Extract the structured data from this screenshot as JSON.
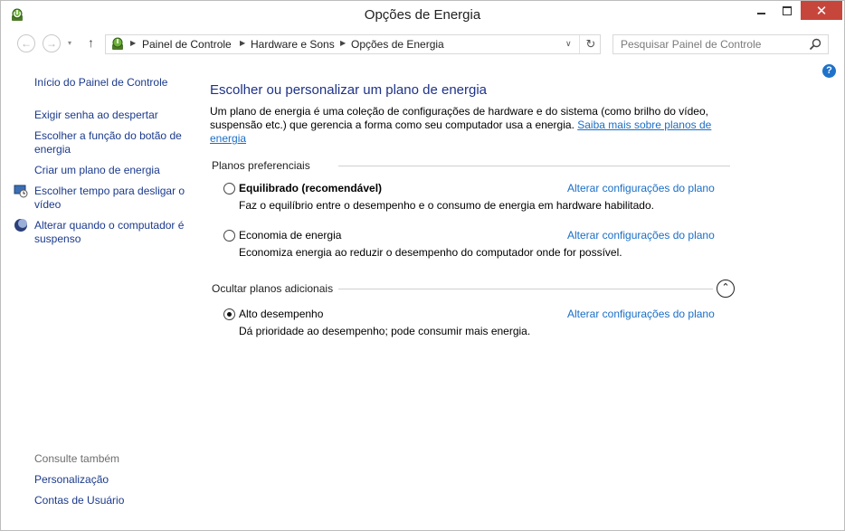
{
  "window": {
    "title": "Opções de Energia",
    "close_glyph": "✕"
  },
  "navigation": {
    "back_glyph": "←",
    "forward_glyph": "→",
    "recent_glyph": "▾",
    "up_glyph": "↑",
    "breadcrumbs": [
      "Painel de Controle",
      "Hardware e Sons",
      "Opções de Energia"
    ],
    "separator_glyph": "▶",
    "dropdown_glyph": "∨",
    "refresh_glyph": "↻",
    "search_placeholder": "Pesquisar Painel de Controle",
    "help_glyph": "?"
  },
  "sidebar": {
    "home": "Início do Painel de Controle",
    "links": [
      "Exigir senha ao despertar",
      "Escolher a função do botão de energia",
      "Criar um plano de energia",
      "Escolher tempo para desligar o vídeo",
      "Alterar quando o computador é suspenso"
    ],
    "see_also_title": "Consulte também",
    "see_also": [
      "Personalização",
      "Contas de Usuário"
    ]
  },
  "main": {
    "title": "Escolher ou personalizar um plano de energia",
    "description": "Um plano de energia é uma coleção de configurações de hardware e do sistema (como brilho do vídeo, suspensão etc.) que gerencia a forma como seu computador usa a energia.",
    "learn_more": "Saiba mais sobre planos de energia",
    "preferred_group": "Planos preferenciais",
    "hidden_group": "Ocultar planos adicionais",
    "collapse_glyph": "⌃",
    "plans": [
      {
        "name": "Equilibrado (recomendável)",
        "description": "Faz o equilíbrio entre o desempenho e o consumo de energia em hardware habilitado.",
        "link": "Alterar configurações do plano",
        "selected": false
      },
      {
        "name": "Economia de energia",
        "description": "Economiza energia ao reduzir o desempenho do computador onde for possível.",
        "link": "Alterar configurações do plano",
        "selected": false
      },
      {
        "name": "Alto desempenho",
        "description": "Dá prioridade ao desempenho; pode consumir mais energia.",
        "link": "Alterar configurações do plano",
        "selected": true
      }
    ]
  },
  "colors": {
    "link": "#1a6ec7",
    "nav_link": "#1b3a8c",
    "heading": "#1e3287",
    "close_button": "#c7463c"
  }
}
